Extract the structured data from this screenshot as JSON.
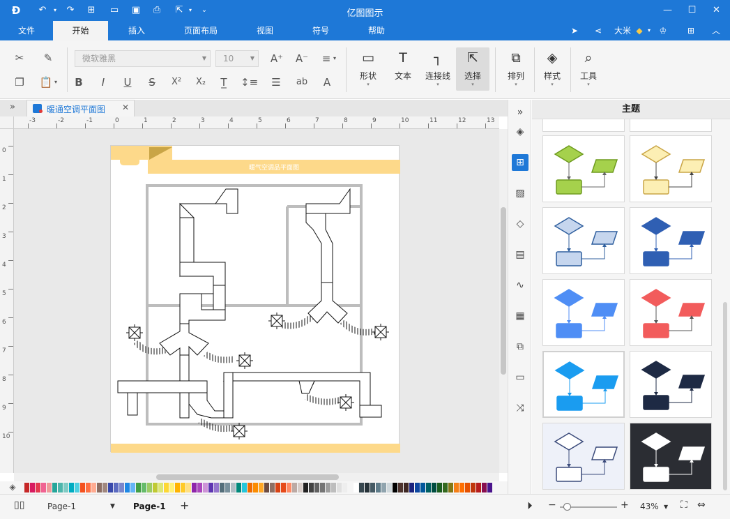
{
  "app": {
    "title": "亿图图示",
    "controls": {
      "minimize": "—",
      "maximize": "☐",
      "close": "✕"
    }
  },
  "menu": {
    "items": [
      "文件",
      "开始",
      "插入",
      "页面布局",
      "视图",
      "符号",
      "帮助"
    ],
    "active_index": 1,
    "user_name": "大米"
  },
  "ribbon": {
    "font_name": "微软雅黑",
    "font_size": "10",
    "tools": [
      "形状",
      "文本",
      "连接线",
      "选择"
    ],
    "active_tool": "选择",
    "arrange_label": "排列",
    "style_label": "样式",
    "tools_label": "工具"
  },
  "document": {
    "tab_title": "暖通空调平面图",
    "diagram_title": "暖气空调品平面图"
  },
  "rulers": {
    "h_labels": [
      "-3",
      "-2",
      "-1",
      "0",
      "1",
      "2",
      "3",
      "4",
      "5",
      "6",
      "7",
      "8",
      "9",
      "10",
      "11",
      "12",
      "13"
    ],
    "v_labels": [
      "0",
      "1",
      "2",
      "3",
      "4",
      "5",
      "6",
      "7",
      "8",
      "9",
      "10"
    ]
  },
  "panel": {
    "title": "主题"
  },
  "status": {
    "page_selector": "Page-1",
    "active_page": "Page-1",
    "add_page": "+",
    "zoom": "43%"
  },
  "colors": {
    "accent": "#1e78d7",
    "header_band": "#fdd98a"
  }
}
